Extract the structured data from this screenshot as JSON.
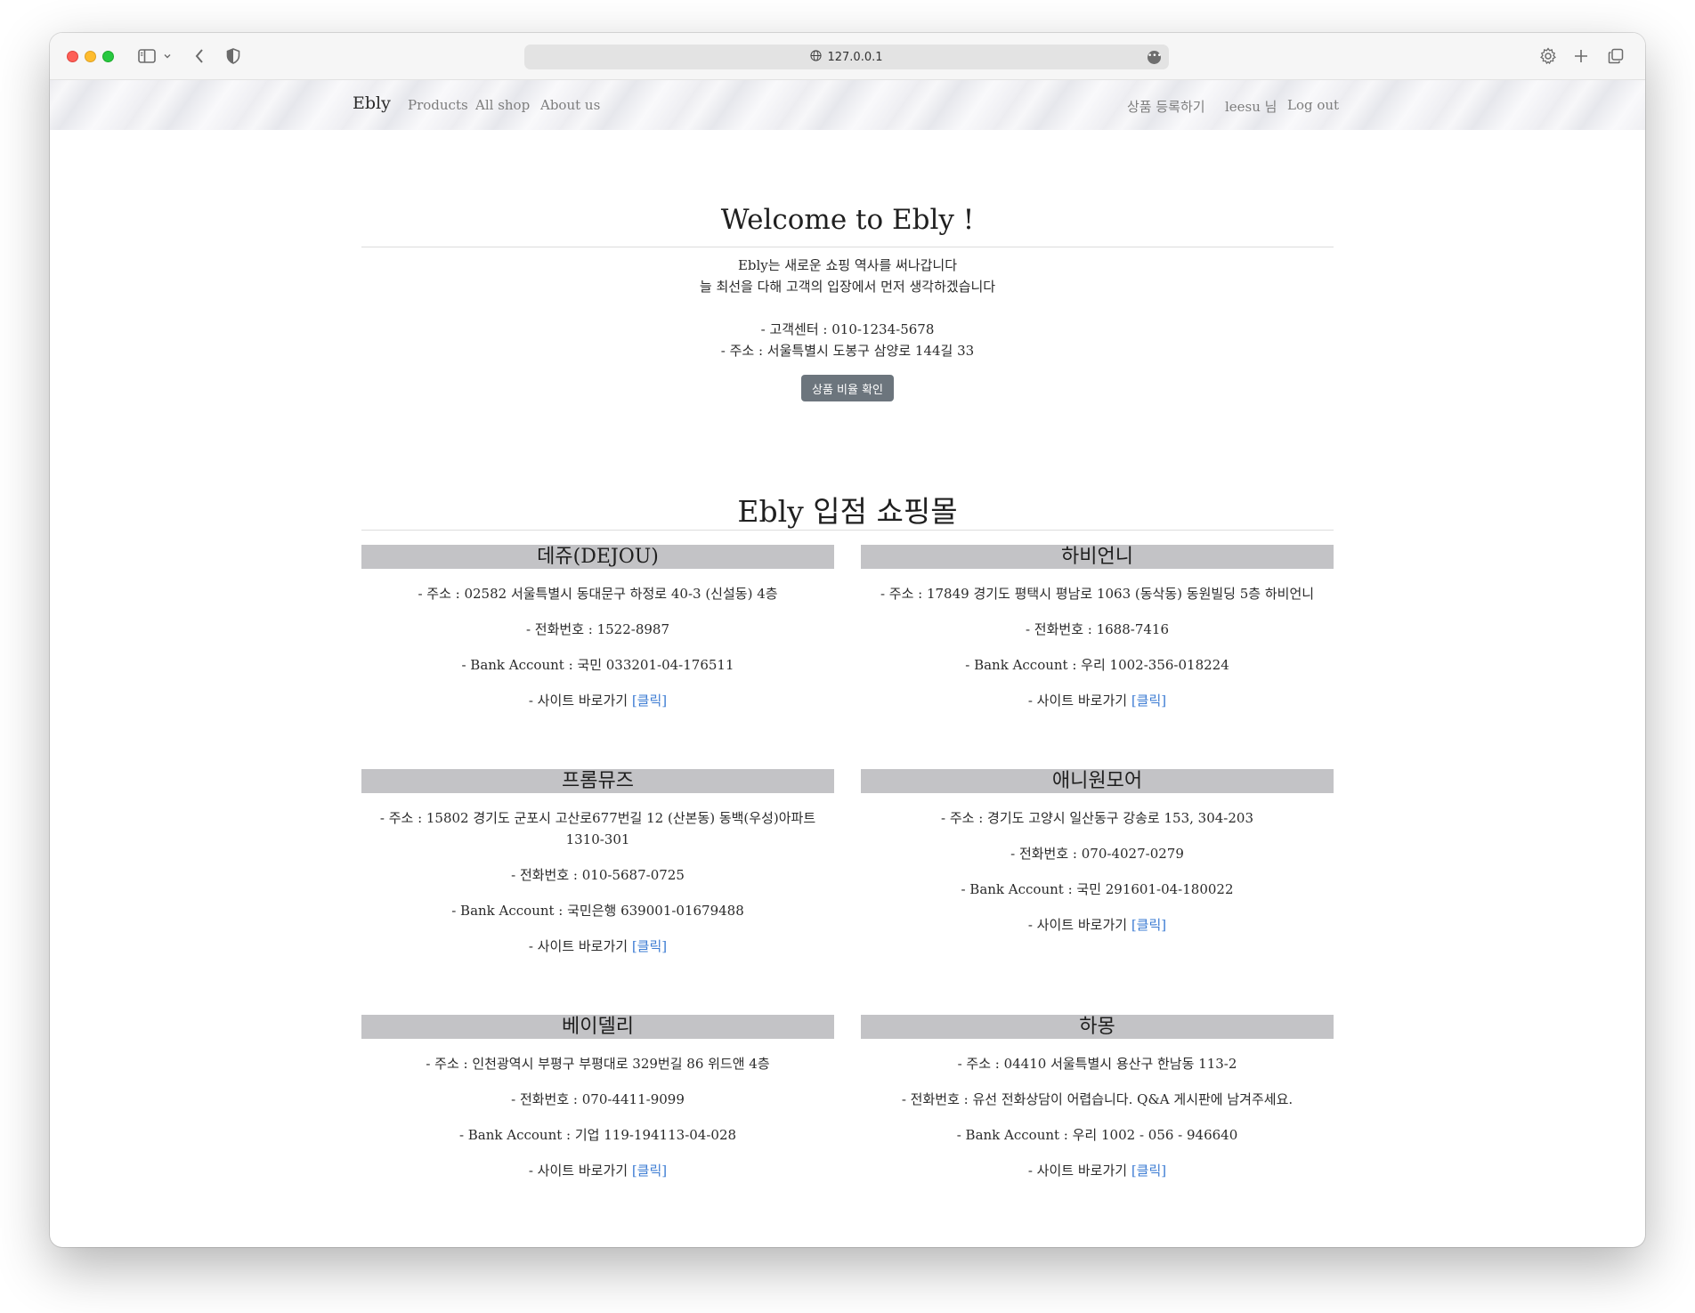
{
  "browser": {
    "url": "127.0.0.1"
  },
  "nav": {
    "brand": "Ebly",
    "links": [
      "Products",
      "All shop",
      "About us"
    ],
    "register": "상품 등록하기",
    "user": "leesu 님",
    "logout": "Log out"
  },
  "hero": {
    "title": "Welcome to Ebly !",
    "lines": [
      "Ebly는 새로운 쇼핑 역사를 써나갑니다",
      "늘 최선을 다해 고객의 입장에서 먼저 생각하겠습니다",
      "- 고객센터 : 010-1234-5678",
      "- 주소 : 서울특별시 도봉구 삼양로 144길 33"
    ],
    "button": "상품 비율 확인"
  },
  "malls": {
    "title": "Ebly 입점 쇼핑몰",
    "link_prefix": "- 사이트 바로가기 ",
    "link_text": "[클릭]",
    "items": [
      {
        "name": "데쥬(DEJOU)",
        "address": "- 주소 : 02582 서울특별시 동대문구 하정로 40-3 (신설동) 4층",
        "phone": "- 전화번호 : 1522-8987",
        "bank": "- Bank Account : 국민 033201-04-176511"
      },
      {
        "name": "하비언니",
        "address": "- 주소 : 17849 경기도 평택시 평남로 1063 (동삭동) 동원빌딩 5층 하비언니",
        "phone": "- 전화번호 : 1688-7416",
        "bank": "- Bank Account : 우리 1002-356-018224"
      },
      {
        "name": "프롬뮤즈",
        "address": "- 주소 : 15802 경기도 군포시 고산로677번길 12 (산본동) 동백(우성)아파트 1310-301",
        "phone": "- 전화번호 : 010-5687-0725",
        "bank": "- Bank Account : 국민은행 639001-01679488"
      },
      {
        "name": "애니원모어",
        "address": "- 주소 : 경기도 고양시 일산동구 강송로 153, 304-203",
        "phone": "- 전화번호 : 070-4027-0279",
        "bank": "- Bank Account : 국민 291601-04-180022"
      },
      {
        "name": "베이델리",
        "address": "- 주소 : 인천광역시 부평구 부평대로 329번길 86 위드앤 4층",
        "phone": "- 전화번호 : 070-4411-9099",
        "bank": "- Bank Account : 기업 119-194113-04-028"
      },
      {
        "name": "하몽",
        "address": "- 주소 : 04410 서울특별시 용산구 한남동 113-2",
        "phone": "- 전화번호 : 유선 전화상담이 어렵습니다. Q&A 게시판에 남겨주세요.",
        "bank": "- Bank Account : 우리 1002 - 056 - 946640"
      }
    ]
  }
}
